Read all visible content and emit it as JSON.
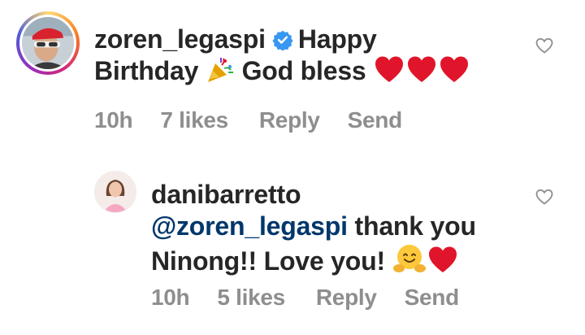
{
  "comments": [
    {
      "username": "zoren_legaspi",
      "verified": true,
      "text_line1": "Happy",
      "text_birthday": "Birthday",
      "text_after_emoji": "God bless",
      "time": "10h",
      "likes": "7 likes",
      "reply_label": "Reply",
      "send_label": "Send",
      "avatar_icon": "profile-photo-avatar",
      "emojis": [
        "party-popper-emoji",
        "red-heart-emoji",
        "red-heart-emoji",
        "red-heart-emoji"
      ]
    },
    {
      "username": "danibarretto",
      "mention": "@zoren_legaspi",
      "text_after_mention": "thank you",
      "text_line2": "Ninong!! Love you!",
      "time": "10h",
      "likes": "5 likes",
      "reply_label": "Reply",
      "send_label": "Send",
      "avatar_icon": "profile-photo-avatar",
      "emojis": [
        "hugging-face-emoji",
        "red-heart-emoji"
      ]
    }
  ],
  "colors": {
    "text": "#262626",
    "meta": "#8e8e8e",
    "mention": "#00376b",
    "verified": "#3897f0",
    "heart": "#e0152b"
  }
}
